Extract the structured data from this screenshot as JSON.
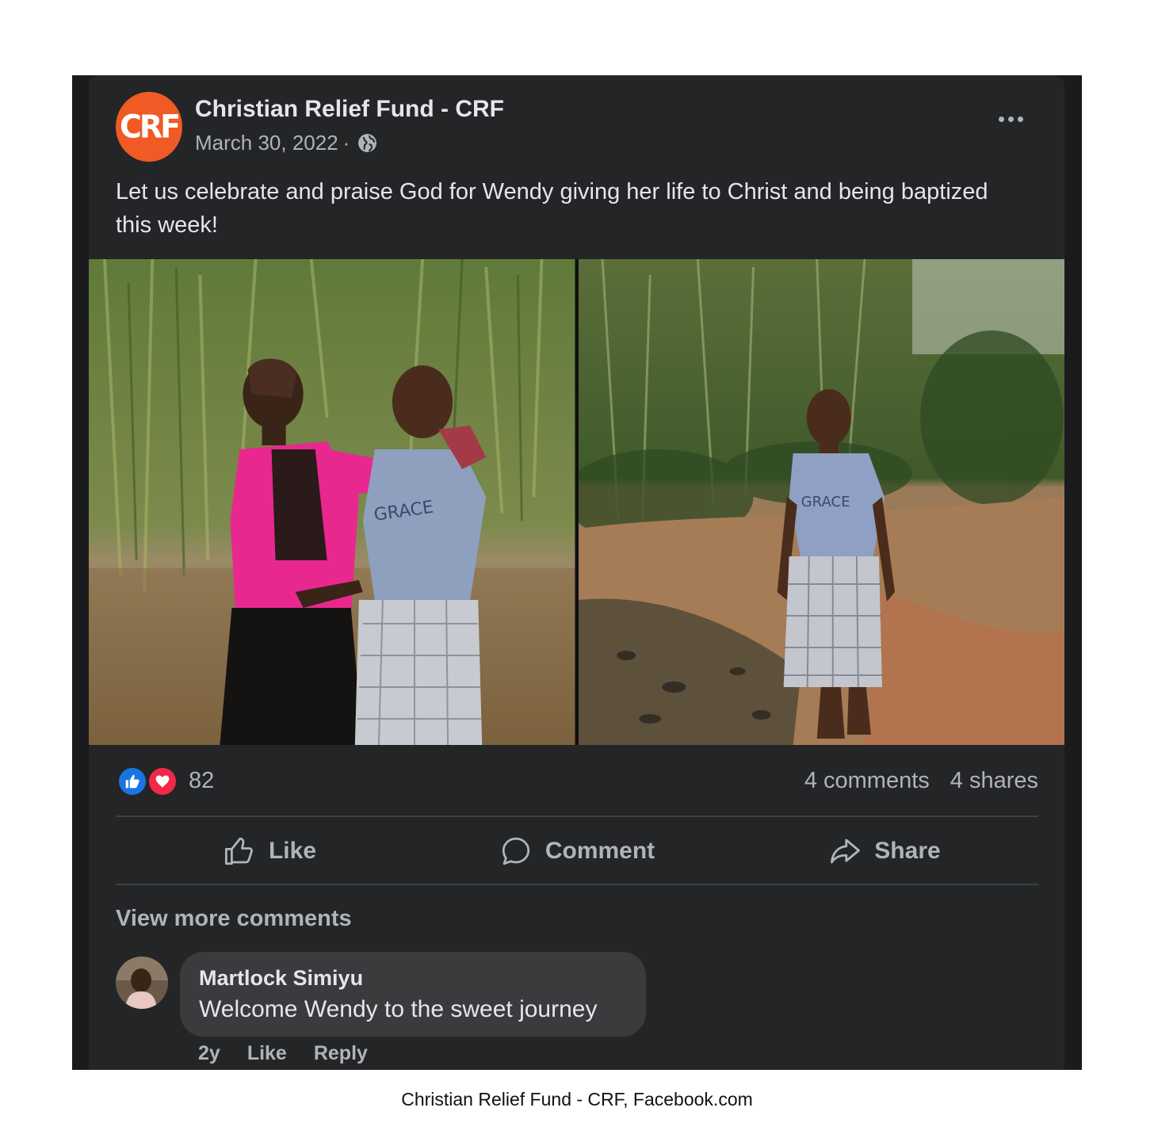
{
  "post": {
    "page_name": "Christian Relief Fund - CRF",
    "avatar_text": "CRF",
    "date": "March 30, 2022",
    "separator": "·",
    "privacy_icon": "globe-icon",
    "text": "Let us celebrate and praise God for Wendy giving her life to Christ and being baptized this week!",
    "photo_text": "GRACE"
  },
  "stats": {
    "reactions_count": "82",
    "reaction_icons": [
      "like-icon",
      "love-icon"
    ],
    "comments": "4 comments",
    "shares": "4 shares"
  },
  "actions": {
    "like": "Like",
    "comment": "Comment",
    "share": "Share"
  },
  "comments": {
    "view_more": "View more comments",
    "items": [
      {
        "author": "Martlock Simiyu",
        "text": "Welcome Wendy to the sweet journey",
        "time": "2y",
        "like": "Like",
        "reply": "Reply"
      }
    ]
  },
  "caption": "Christian Relief Fund - CRF, Facebook.com",
  "colors": {
    "card_bg": "#242526",
    "frame_bg": "#1b1b1d",
    "text_primary": "#e4e6eb",
    "text_secondary": "#b0b3b8",
    "brand_orange": "#ef5a25",
    "like_blue": "#1b74e4",
    "love_red": "#f02849"
  }
}
